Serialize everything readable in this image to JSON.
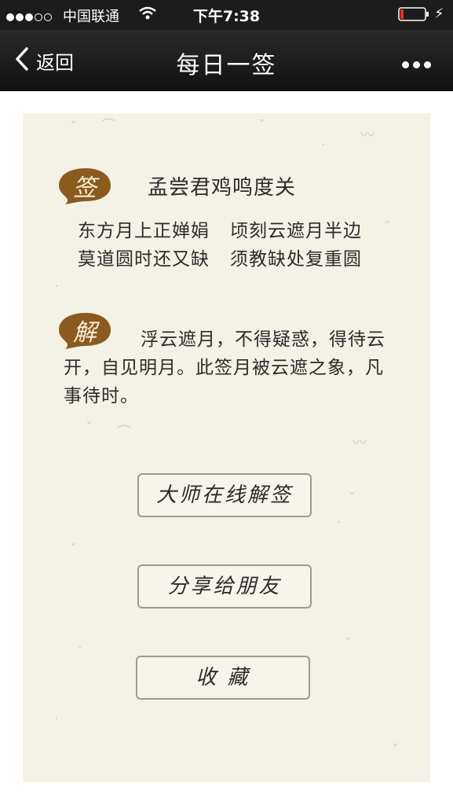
{
  "status_bar": {
    "signal_bars_filled": 3,
    "signal_bars_total": 5,
    "carrier": "中国联通",
    "time": "下午7:38",
    "battery_level": 0.1
  },
  "nav": {
    "back_label": "返回",
    "title": "每日一签"
  },
  "fortune": {
    "badge_sign": "签",
    "poem_title": "孟尝君鸡鸣度关",
    "poem_lines": [
      [
        "东方月上正婵娟",
        "顷刻云遮月半边"
      ],
      [
        "莫道圆时还又缺",
        "须教缺处复重圆"
      ]
    ],
    "badge_explain": "解",
    "explanation": "浮云遮月，不得疑惑，得待云开，自见明月。此签月被云遮之象，凡事待时。"
  },
  "buttons": {
    "master": "大师在线解签",
    "share": "分享给朋友",
    "favorite": "收 藏"
  },
  "colors": {
    "card_bg": "#f4f1e7",
    "badge": "#8b5a1e",
    "nav_bg": "#1c1c1c"
  }
}
